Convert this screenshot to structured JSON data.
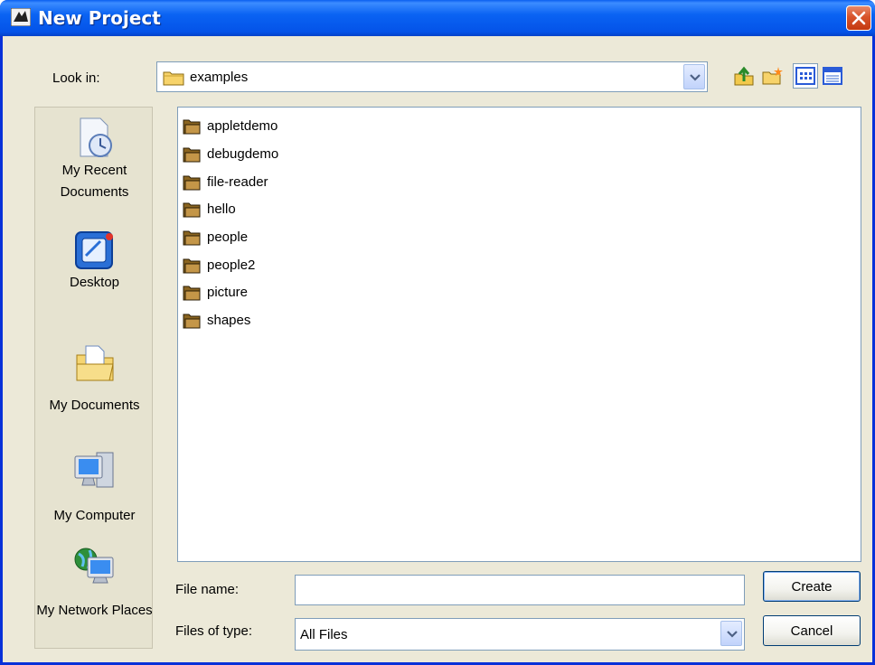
{
  "window": {
    "title": "New Project",
    "close_glyph": "✕"
  },
  "lookin": {
    "label": "Look in:",
    "value": "examples"
  },
  "toolbar": {
    "icons": [
      "up-one-level-icon",
      "create-new-folder-icon",
      "list-view-icon",
      "details-view-icon"
    ]
  },
  "places": [
    {
      "label": "My Recent Documents",
      "icon": "recent-documents-icon"
    },
    {
      "label": "Desktop",
      "icon": "desktop-icon"
    },
    {
      "label": "My Documents",
      "icon": "my-documents-icon"
    },
    {
      "label": "My Computer",
      "icon": "my-computer-icon"
    },
    {
      "label": "My Network Places",
      "icon": "network-places-icon"
    }
  ],
  "files": [
    "appletdemo",
    "debugdemo",
    "file-reader",
    "hello",
    "people",
    "people2",
    "picture",
    "shapes"
  ],
  "filename": {
    "label": "File name:",
    "value": ""
  },
  "filetype": {
    "label": "Files of type:",
    "value": "All Files"
  },
  "buttons": {
    "create": "Create",
    "cancel": "Cancel"
  },
  "colors": {
    "titlebar": "#0a5ff0",
    "dialog_bg": "#ece9d8",
    "close": "#d8532a"
  }
}
